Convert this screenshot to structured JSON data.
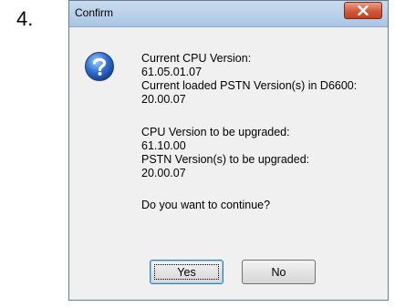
{
  "step": {
    "number": "4."
  },
  "dialog": {
    "title": "Confirm",
    "icon": "question-icon",
    "lines": {
      "cpu_label": "Current CPU Version:",
      "cpu_value": "61.05.01.07",
      "pstn_label": "Current loaded PSTN Version(s) in D6600:",
      "pstn_value": "20.00.07",
      "cpu_upgrade_label": "CPU Version to be upgraded:",
      "cpu_upgrade_value": "61.10.00",
      "pstn_upgrade_label": "PSTN Version(s) to be upgraded:",
      "pstn_upgrade_value": "20.00.07",
      "question": "Do you want to continue?"
    },
    "buttons": {
      "yes": "Yes",
      "no": "No"
    }
  }
}
